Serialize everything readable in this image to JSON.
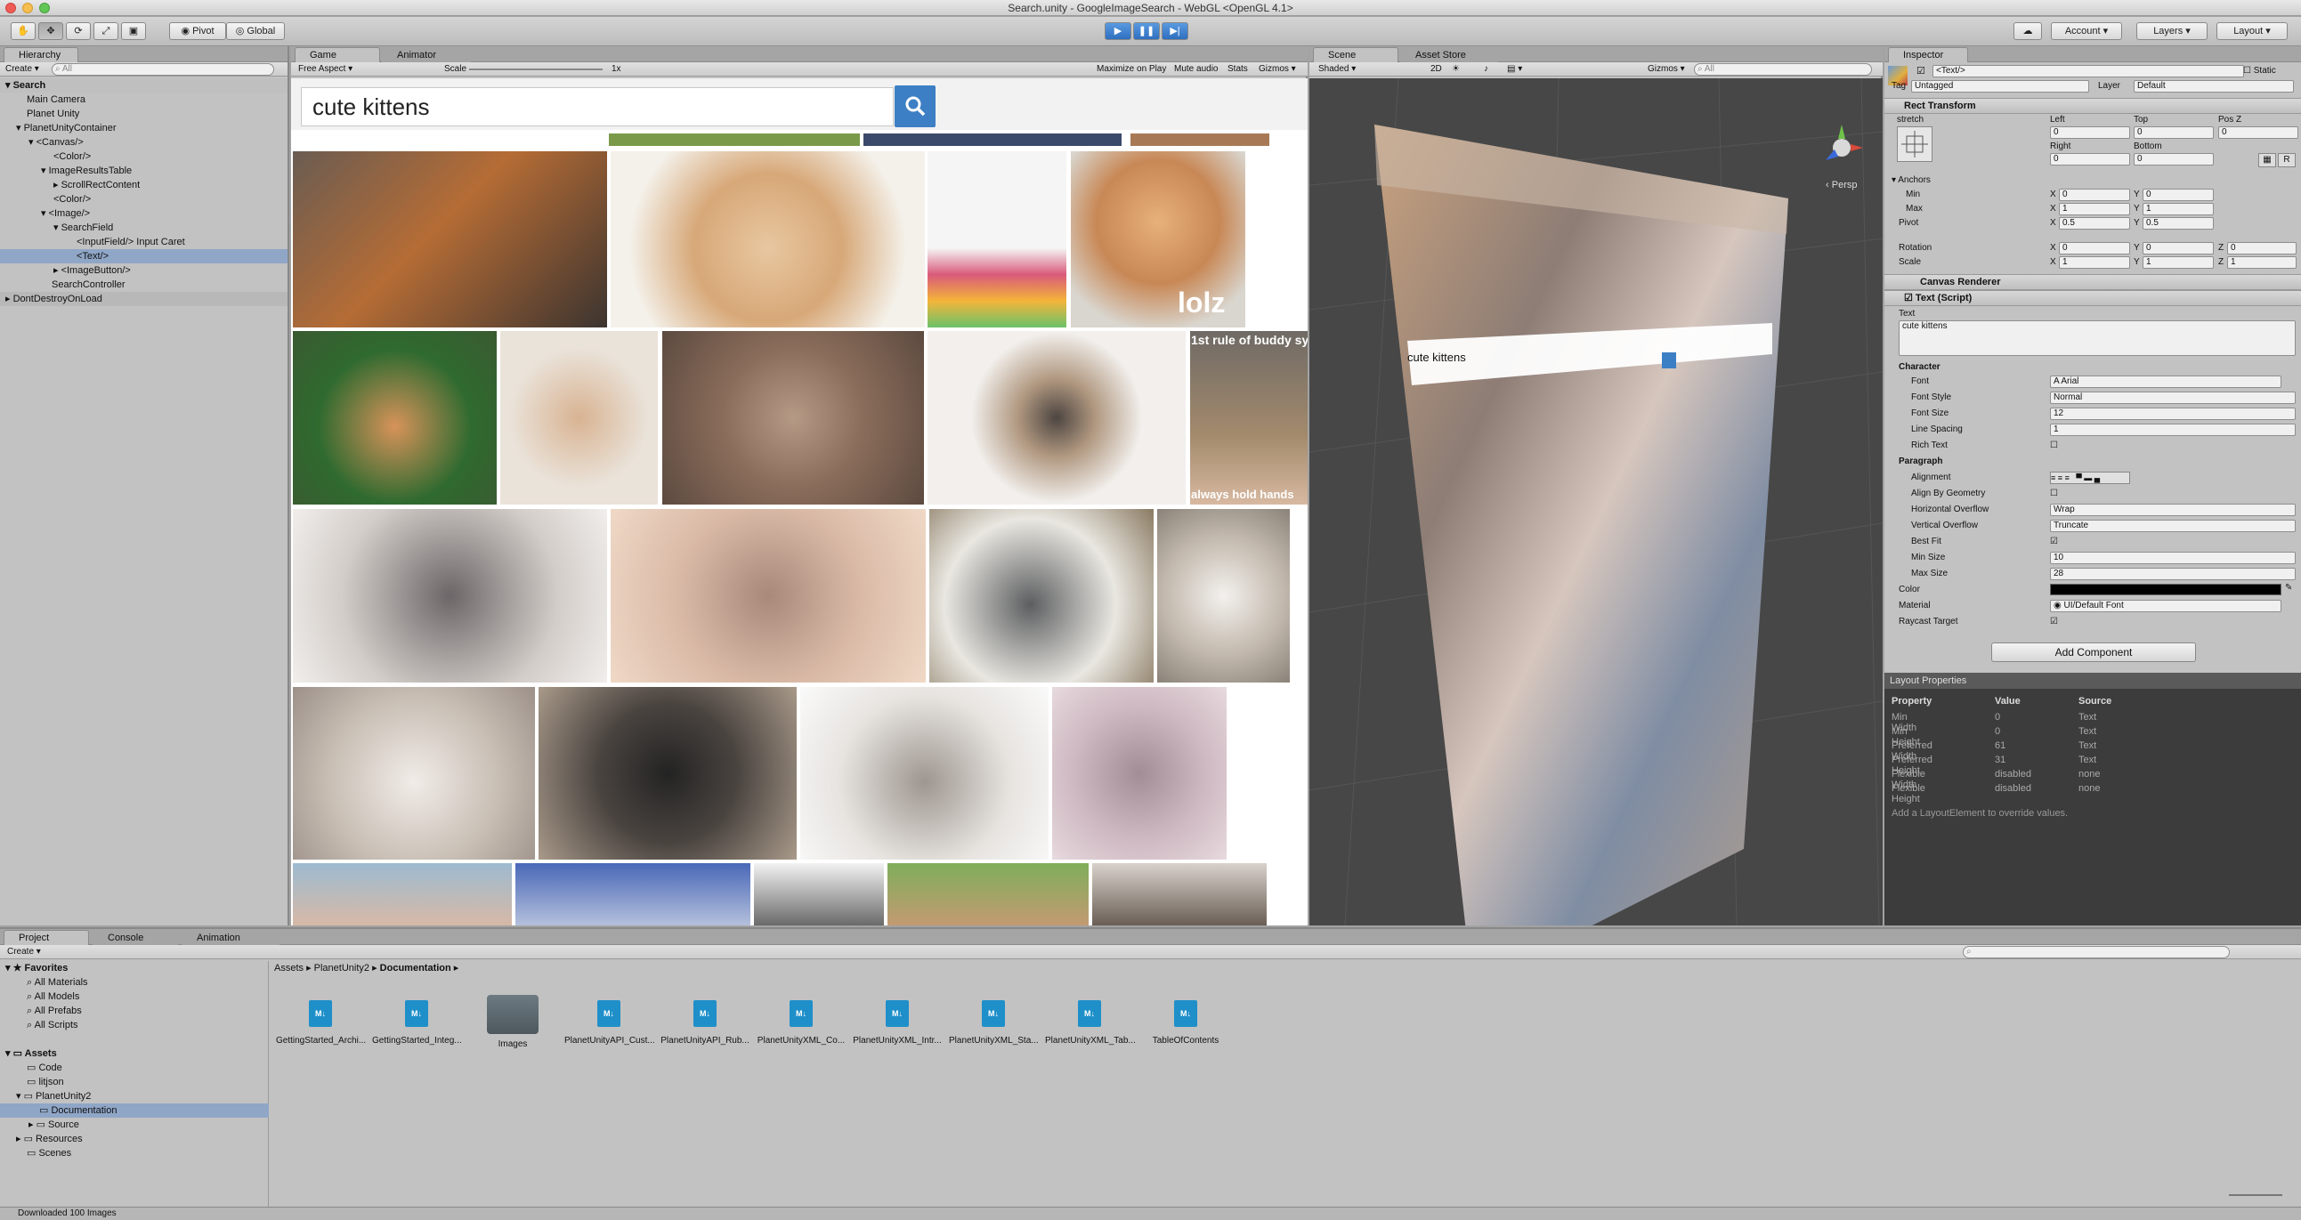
{
  "window": {
    "title": "Search.unity - GoogleImageSearch - WebGL <OpenGL 4.1>"
  },
  "toolbar": {
    "pivot": "Pivot",
    "global": "Global",
    "account": "Account",
    "layers": "Layers",
    "layout": "Layout"
  },
  "hierarchy": {
    "tab": "Hierarchy",
    "create": "Create",
    "search_placeholder": "All",
    "items": [
      {
        "label": "Search",
        "bold": true
      },
      {
        "label": "Main Camera"
      },
      {
        "label": "Planet Unity"
      },
      {
        "label": "PlanetUnityContainer"
      },
      {
        "label": "<Canvas/>"
      },
      {
        "label": "<Color/>"
      },
      {
        "label": "ImageResultsTable"
      },
      {
        "label": "ScrollRectContent"
      },
      {
        "label": "<Color/>"
      },
      {
        "label": "<Image/>"
      },
      {
        "label": "SearchField"
      },
      {
        "label": "<InputField/> Input Caret"
      },
      {
        "label": "<Text/>"
      },
      {
        "label": "<ImageButton/>"
      },
      {
        "label": "SearchController"
      },
      {
        "label": "DontDestroyOnLoad"
      }
    ]
  },
  "game": {
    "tab_game": "Game",
    "tab_animator": "Animator",
    "aspect": "Free Aspect",
    "scale_label": "Scale",
    "scale_value": "1x",
    "maximize": "Maximize on Play",
    "mute": "Mute audio",
    "stats": "Stats",
    "gizmos": "Gizmos",
    "search_text": "cute kittens",
    "meme_lolz": "lolz",
    "meme_buddy": "1st rule of buddy syst",
    "meme_hands": "always hold hands"
  },
  "scene": {
    "tab_scene": "Scene",
    "tab_asset_store": "Asset Store",
    "shading": "Shaded",
    "mode_2d": "2D",
    "gizmos": "Gizmos",
    "search_placeholder": "All",
    "persp": "Persp",
    "search_text": "cute kittens"
  },
  "inspector": {
    "tab": "Inspector",
    "object_name": "<Text/>",
    "static": "Static",
    "tag_label": "Tag",
    "tag_value": "Untagged",
    "layer_label": "Layer",
    "layer_value": "Default",
    "rect_transform": "Rect Transform",
    "stretch": "stretch",
    "left": "Left",
    "top": "Top",
    "posz": "Pos Z",
    "right": "Right",
    "bottom": "Bottom",
    "left_v": "0",
    "top_v": "0",
    "posz_v": "0",
    "right_v": "0",
    "bottom_v": "0",
    "anchors": "Anchors",
    "min": "Min",
    "max": "Max",
    "pivot": "Pivot",
    "min_x": "0",
    "min_y": "0",
    "max_x": "1",
    "max_y": "1",
    "pivot_x": "0.5",
    "pivot_y": "0.5",
    "rotation": "Rotation",
    "scale": "Scale",
    "rot_x": "0",
    "rot_y": "0",
    "rot_z": "0",
    "scale_x": "1",
    "scale_y": "1",
    "scale_z": "1",
    "canvas_renderer": "Canvas Renderer",
    "text_script": "Text (Script)",
    "text_label": "Text",
    "text_value": "cute kittens",
    "character": "Character",
    "font": "Font",
    "font_v": "Arial",
    "font_style": "Font Style",
    "font_style_v": "Normal",
    "font_size": "Font Size",
    "font_size_v": "12",
    "line_spacing": "Line Spacing",
    "line_spacing_v": "1",
    "rich_text": "Rich Text",
    "paragraph": "Paragraph",
    "alignment": "Alignment",
    "align_geom": "Align By Geometry",
    "h_overflow": "Horizontal Overflow",
    "h_overflow_v": "Wrap",
    "v_overflow": "Vertical Overflow",
    "v_overflow_v": "Truncate",
    "best_fit": "Best Fit",
    "min_size": "Min Size",
    "min_size_v": "10",
    "max_size": "Max Size",
    "max_size_v": "28",
    "color": "Color",
    "material": "Material",
    "material_v": "UI/Default Font",
    "raycast": "Raycast Target",
    "add_component": "Add Component",
    "layout_props": "Layout Properties",
    "lp_headers": [
      "Property",
      "Value",
      "Source"
    ],
    "lp_rows": [
      [
        "Min Width",
        "0",
        "Text"
      ],
      [
        "Min Height",
        "0",
        "Text"
      ],
      [
        "Preferred Width",
        "61",
        "Text"
      ],
      [
        "Preferred Height",
        "31",
        "Text"
      ],
      [
        "Flexible Width",
        "disabled",
        "none"
      ],
      [
        "Flexible Height",
        "disabled",
        "none"
      ]
    ],
    "lp_note": "Add a LayoutElement to override values."
  },
  "project": {
    "tab_project": "Project",
    "tab_console": "Console",
    "tab_animation": "Animation",
    "create": "Create",
    "favorites": "Favorites",
    "fav_items": [
      "All Materials",
      "All Models",
      "All Prefabs",
      "All Scripts"
    ],
    "assets": "Assets",
    "asset_tree": [
      "Code",
      "litjson",
      "PlanetUnity2",
      "Documentation",
      "Source",
      "Resources",
      "Scenes"
    ],
    "breadcrumb": [
      "Assets",
      "PlanetUnity2",
      "Documentation"
    ],
    "files": [
      {
        "name": "GettingStarted_Archi...",
        "type": "md"
      },
      {
        "name": "GettingStarted_Integ...",
        "type": "md"
      },
      {
        "name": "Images",
        "type": "folder"
      },
      {
        "name": "PlanetUnityAPI_Cust...",
        "type": "md"
      },
      {
        "name": "PlanetUnityAPI_Rub...",
        "type": "md"
      },
      {
        "name": "PlanetUnityXML_Co...",
        "type": "md"
      },
      {
        "name": "PlanetUnityXML_Intr...",
        "type": "md"
      },
      {
        "name": "PlanetUnityXML_Sta...",
        "type": "md"
      },
      {
        "name": "PlanetUnityXML_Tab...",
        "type": "md"
      },
      {
        "name": "TableOfContents",
        "type": "md"
      }
    ]
  },
  "status": {
    "text": "Downloaded 100 Images"
  },
  "colors": {
    "accent": "#3d7fc4",
    "selection": "#8fa6c7",
    "scene_bg": "#474747"
  }
}
